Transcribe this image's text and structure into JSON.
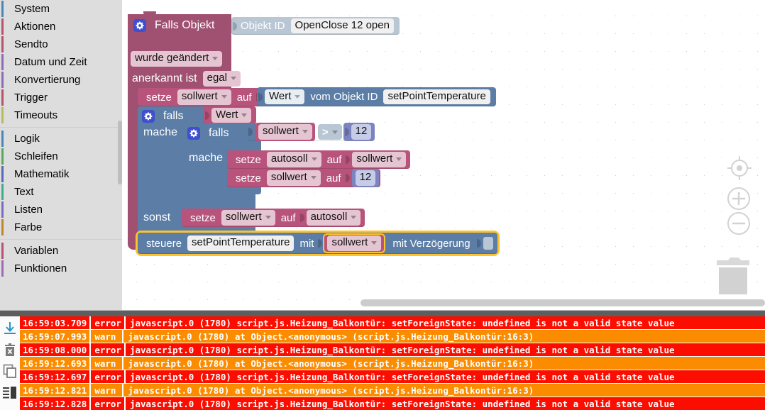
{
  "toolbox": {
    "groups": [
      {
        "items": [
          {
            "label": "System",
            "color": "#4a86b8"
          },
          {
            "label": "Aktionen",
            "color": "#b8526e"
          },
          {
            "label": "Sendto",
            "color": "#b8526e"
          },
          {
            "label": "Datum und Zeit",
            "color": "#8f6bb5"
          },
          {
            "label": "Konvertierung",
            "color": "#8f6bb5"
          },
          {
            "label": "Trigger",
            "color": "#b8526e"
          },
          {
            "label": "Timeouts",
            "color": "#b5bd5a"
          }
        ]
      },
      {
        "items": [
          {
            "label": "Logik",
            "color": "#4a86b8"
          },
          {
            "label": "Schleifen",
            "color": "#5aa95a"
          },
          {
            "label": "Mathematik",
            "color": "#5a68b5"
          },
          {
            "label": "Text",
            "color": "#3fae8f"
          },
          {
            "label": "Listen",
            "color": "#7b6bc4"
          },
          {
            "label": "Farbe",
            "color": "#c1872a"
          }
        ]
      },
      {
        "items": [
          {
            "label": "Variablen",
            "color": "#b8526e"
          },
          {
            "label": "Funktionen",
            "color": "#a06bb8"
          }
        ]
      }
    ]
  },
  "workspace": {
    "trigger_block": {
      "title": "Falls Objekt",
      "objekt_id_label": "Objekt ID",
      "objekt_id_value": "OpenClose 12 open",
      "condition_field": "wurde geändert",
      "ack_label": "anerkannt ist",
      "ack_field": "egal"
    },
    "set_sollwert_from_state": {
      "setze_label": "setze",
      "var_field": "sollwert",
      "auf_label": "auf",
      "attr_field": "Wert",
      "vom_label": "vom Objekt ID",
      "obj_field": "setPointTemperature"
    },
    "if_outer": {
      "if_label": "falls",
      "cond_field": "Wert",
      "do_label": "mache",
      "else_label": "sonst"
    },
    "if_inner": {
      "if_label": "falls",
      "left_var": "sollwert",
      "operator": ">",
      "right_number": "12",
      "do_label": "mache"
    },
    "set_autosoll": {
      "setze_label": "setze",
      "var_field": "autosoll",
      "auf_label": "auf",
      "value_var": "sollwert"
    },
    "set_sollwert_12": {
      "setze_label": "setze",
      "var_field": "sollwert",
      "auf_label": "auf",
      "value_number": "12"
    },
    "set_sollwert_autosoll": {
      "setze_label": "setze",
      "var_field": "sollwert",
      "auf_label": "auf",
      "value_var": "autosoll"
    },
    "control_block": {
      "steuere_label": "steuere",
      "target_field": "setPointTemperature",
      "mit_label": "mit",
      "value_var": "sollwert",
      "delay_label": "mit Verzögerung",
      "selected": true,
      "selection_color": "#fcc32c"
    },
    "controls": {
      "center_icon": "center-target-icon",
      "zoom_in_icon": "zoom-in-icon",
      "zoom_out_icon": "zoom-out-icon",
      "trash_icon": "trash-icon",
      "zoom_in_label": "+",
      "zoom_out_label": "−"
    }
  },
  "log": {
    "tools": [
      {
        "icon": "download-icon",
        "name": "download-log"
      },
      {
        "icon": "trash-icon",
        "name": "clear-log"
      },
      {
        "icon": "copy-icon",
        "name": "copy-log"
      },
      {
        "icon": "list-layout-icon",
        "name": "toggle-log-layout"
      }
    ],
    "colors": {
      "error": "#fb0d00",
      "warn": "#fb8c00"
    },
    "rows": [
      {
        "ts": "16:59:03.709",
        "sev": "error",
        "msg": "javascript.0 (1780) script.js.Heizung_Balkontür: setForeignState: undefined is not a valid state value"
      },
      {
        "ts": "16:59:07.993",
        "sev": "warn",
        "msg": "javascript.0 (1780) at Object.<anonymous> (script.js.Heizung_Balkontür:16:3)"
      },
      {
        "ts": "16:59:08.000",
        "sev": "error",
        "msg": "javascript.0 (1780) script.js.Heizung_Balkontür: setForeignState: undefined is not a valid state value"
      },
      {
        "ts": "16:59:12.693",
        "sev": "warn",
        "msg": "javascript.0 (1780) at Object.<anonymous> (script.js.Heizung_Balkontür:16:3)"
      },
      {
        "ts": "16:59:12.697",
        "sev": "error",
        "msg": "javascript.0 (1780) script.js.Heizung_Balkontür: setForeignState: undefined is not a valid state value"
      },
      {
        "ts": "16:59:12.821",
        "sev": "warn",
        "msg": "javascript.0 (1780) at Object.<anonymous> (script.js.Heizung_Balkontür:16:3)"
      },
      {
        "ts": "16:59:12.828",
        "sev": "error",
        "msg": "javascript.0 (1780) script.js.Heizung_Balkontür: setForeignState: undefined is not a valid state value"
      }
    ]
  }
}
